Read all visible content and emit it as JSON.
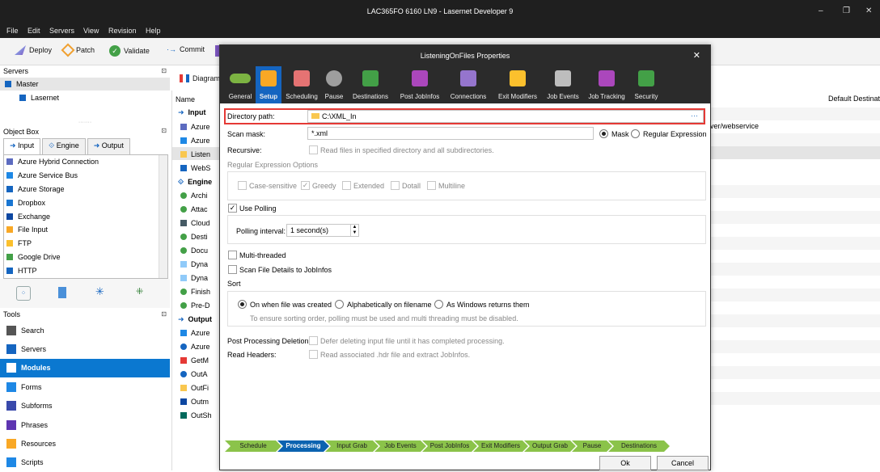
{
  "window": {
    "title": "LAC365FO 6160 LN9 - Lasernet Developer 9",
    "controls": [
      "–",
      "❐",
      "✕"
    ]
  },
  "menu": [
    "File",
    "Edit",
    "Servers",
    "View",
    "Revision",
    "Help"
  ],
  "toolbar": {
    "deploy": "Deploy",
    "patch": "Patch",
    "validate": "Validate",
    "commit": "Commit",
    "diagram": "Diagram"
  },
  "servers_panel": {
    "title": "Servers",
    "items": [
      "Master",
      "Lasernet"
    ]
  },
  "object_box": {
    "title": "Object Box",
    "tabs": [
      "Input",
      "Engine",
      "Output"
    ],
    "items": [
      {
        "label": "Azure Hybrid Connection",
        "color": "#5c6bc0"
      },
      {
        "label": "Azure Service Bus",
        "color": "#1e88e5"
      },
      {
        "label": "Azure Storage",
        "color": "#1565c0"
      },
      {
        "label": "Dropbox",
        "color": "#1976d2"
      },
      {
        "label": "Exchange",
        "color": "#0d47a1"
      },
      {
        "label": "File Input",
        "color": "#f9a825"
      },
      {
        "label": "FTP",
        "color": "#fbc02d"
      },
      {
        "label": "Google Drive",
        "color": "#43a047"
      },
      {
        "label": "HTTP",
        "color": "#1565c0"
      }
    ]
  },
  "tools_panel": {
    "title": "Tools",
    "items": [
      {
        "label": "Search",
        "color": "#555555"
      },
      {
        "label": "Servers",
        "color": "#1565c0"
      },
      {
        "label": "Modules",
        "color": "#ffffff"
      },
      {
        "label": "Forms",
        "color": "#1e88e5"
      },
      {
        "label": "Subforms",
        "color": "#3949ab"
      },
      {
        "label": "Phrases",
        "color": "#5e35b1"
      },
      {
        "label": "Resources",
        "color": "#f9a825"
      },
      {
        "label": "Scripts",
        "color": "#1e88e5"
      }
    ]
  },
  "modules": {
    "name_header": "Name",
    "input_header": "Input",
    "input_items": [
      "Azure",
      "Azure",
      "Listen",
      "WebS"
    ],
    "engine_header": "Engine",
    "engine_items": [
      "Archi",
      "Attac",
      "Cloud",
      "Desti",
      "Docu",
      "Dyna",
      "Dyna",
      "Finish",
      "Pre-D"
    ],
    "output_header": "Output",
    "output_items": [
      "Azure",
      "Azure",
      "GetM",
      "OutA",
      "OutFi",
      "Outm",
      "OutSh"
    ]
  },
  "right_columns": {
    "default_dest_header": "Default Destinat",
    "row_text": "ver/webservice"
  },
  "dialog": {
    "title": "ListeningOnFiles Properties",
    "close": "✕",
    "tabs": [
      {
        "label": "General",
        "color": "#7cb342"
      },
      {
        "label": "Setup",
        "color": "#f9a825"
      },
      {
        "label": "Scheduling",
        "color": "#e57373"
      },
      {
        "label": "Pause",
        "color": "#9e9e9e"
      },
      {
        "label": "Destinations",
        "color": "#43a047"
      },
      {
        "label": "Post JobInfos",
        "color": "#ab47bc"
      },
      {
        "label": "Connections",
        "color": "#9575cd"
      },
      {
        "label": "Exit Modifiers",
        "color": "#fbc02d"
      },
      {
        "label": "Job Events",
        "color": "#bdbdbd"
      },
      {
        "label": "Job Tracking",
        "color": "#ab47bc"
      },
      {
        "label": "Security",
        "color": "#43a047"
      }
    ],
    "directory_label": "Directory path:",
    "directory_value": "C:\\XML_In",
    "directory_more": "···",
    "scan_mask_label": "Scan mask:",
    "scan_mask_value": "*.xml",
    "mask_radio": "Mask",
    "regex_radio": "Regular Expression",
    "recursive_label": "Recursive:",
    "recursive_text": "Read files in specified directory and all subdirectories.",
    "regex_options_title": "Regular Expression Options",
    "regex_options": [
      "Case-sensitive",
      "Greedy",
      "Extended",
      "Dotall",
      "Multiline"
    ],
    "use_polling": "Use Polling",
    "polling_interval_label": "Polling interval:",
    "polling_interval_value": "1 second(s)",
    "multi_threaded": "Multi-threaded",
    "scan_file_details": "Scan File Details to JobInfos",
    "sort_title": "Sort",
    "sort_options": [
      "On when file was created",
      "Alphabetically on filename",
      "As Windows returns them"
    ],
    "sort_note": "To ensure sorting order, polling must be used and multi threading must be disabled.",
    "post_processing_label": "Post Processing Deletion:",
    "post_processing_text": "Defer deleting input file until it has completed processing.",
    "read_headers_label": "Read Headers:",
    "read_headers_text": "Read associated .hdr file and extract JobInfos.",
    "steps": [
      "Schedule",
      "Processing",
      "Input Grab",
      "Job Events",
      "Post JobInfos",
      "Exit Modifiers",
      "Output Grab",
      "Pause",
      "Destinations"
    ],
    "ok": "Ok",
    "cancel": "Cancel",
    "highlight_color": "#e53935"
  }
}
